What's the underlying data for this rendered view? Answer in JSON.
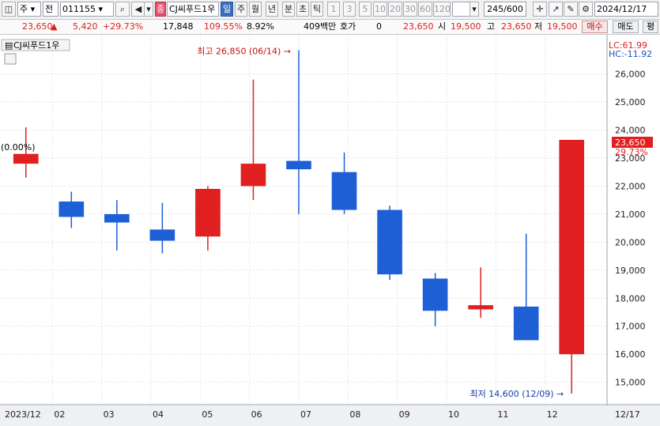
{
  "toolbar": {
    "market": "주",
    "market_type": "전",
    "code": "011155",
    "stock_badge": "종",
    "name": "CJ씨푸드1우",
    "periods": [
      "일",
      "주",
      "월",
      "년",
      "분",
      "초",
      "틱"
    ],
    "minute_options": [
      "1",
      "3",
      "5",
      "10",
      "20",
      "30",
      "60",
      "120"
    ],
    "count": "245/600",
    "date": "2024/12/17"
  },
  "quote": {
    "price": "23,650",
    "arrow": "▲",
    "change": "5,420",
    "change_pct": "+29.73%",
    "volume": "17,848",
    "volume_ratio": "109.55%",
    "turnover": "8.92%",
    "amount": "409백만",
    "bid_label": "호가",
    "bid_value": "0",
    "bid_price": "23,650",
    "open_label": "시",
    "open": "19,500",
    "high_label": "고",
    "high": "23,650",
    "low_label": "저",
    "low": "19,500",
    "buy_label": "매수",
    "sell_label": "매도",
    "avg_label": "평"
  },
  "chart_data": {
    "type": "candlestick",
    "title": "CJ씨푸드1우",
    "ylim": [
      14200,
      27400
    ],
    "yticks": [
      15000,
      16000,
      17000,
      18000,
      19000,
      20000,
      21000,
      22000,
      23000,
      24000,
      25000,
      26000
    ],
    "ytick_labels": [
      "15,000",
      "16,000",
      "17,000",
      "18,000",
      "19,000",
      "20,000",
      "21,000",
      "22,000",
      "23,000",
      "24,000",
      "25,000",
      "26,000"
    ],
    "x_labels": [
      "2023/12",
      "02",
      "03",
      "04",
      "05",
      "06",
      "07",
      "08",
      "09",
      "10",
      "11",
      "12",
      "12/17"
    ],
    "up_color": "#e02020",
    "down_color": "#1f5fd6",
    "lc": "LC:61.99",
    "hc": "HC:-11.92",
    "current_price_label": "23,650",
    "current_pct_label": "29.73%",
    "left_tag": "(0.00%)",
    "high_annotation": "최고 26,850 (06/14)",
    "low_annotation": "최저 14,600 (12/09)",
    "series": [
      {
        "date": "2023-12",
        "open": 22800,
        "high": 24100,
        "low": 22300,
        "close": 23150
      },
      {
        "date": "2024-01",
        "open": 21450,
        "high": 21800,
        "low": 20500,
        "close": 20900
      },
      {
        "date": "2024-02",
        "open": 21000,
        "high": 21500,
        "low": 19700,
        "close": 20700
      },
      {
        "date": "2024-03",
        "open": 20450,
        "high": 21400,
        "low": 19600,
        "close": 20050
      },
      {
        "date": "2024-04",
        "open": 20200,
        "high": 22000,
        "low": 19700,
        "close": 21900
      },
      {
        "date": "2024-05",
        "open": 22000,
        "high": 25800,
        "low": 21500,
        "close": 22800
      },
      {
        "date": "2024-06",
        "open": 22900,
        "high": 26850,
        "low": 21000,
        "close": 22600
      },
      {
        "date": "2024-07",
        "open": 22500,
        "high": 23200,
        "low": 21000,
        "close": 21150
      },
      {
        "date": "2024-08",
        "open": 21150,
        "high": 21300,
        "low": 18650,
        "close": 18850
      },
      {
        "date": "2024-09",
        "open": 18700,
        "high": 18900,
        "low": 17000,
        "close": 17550
      },
      {
        "date": "2024-10",
        "open": 17600,
        "high": 19100,
        "low": 17300,
        "close": 17750
      },
      {
        "date": "2024-11",
        "open": 17700,
        "high": 20300,
        "low": 16800,
        "close": 16500
      },
      {
        "date": "2024-12",
        "open": 16000,
        "high": 23650,
        "low": 14600,
        "close": 23650
      }
    ]
  }
}
